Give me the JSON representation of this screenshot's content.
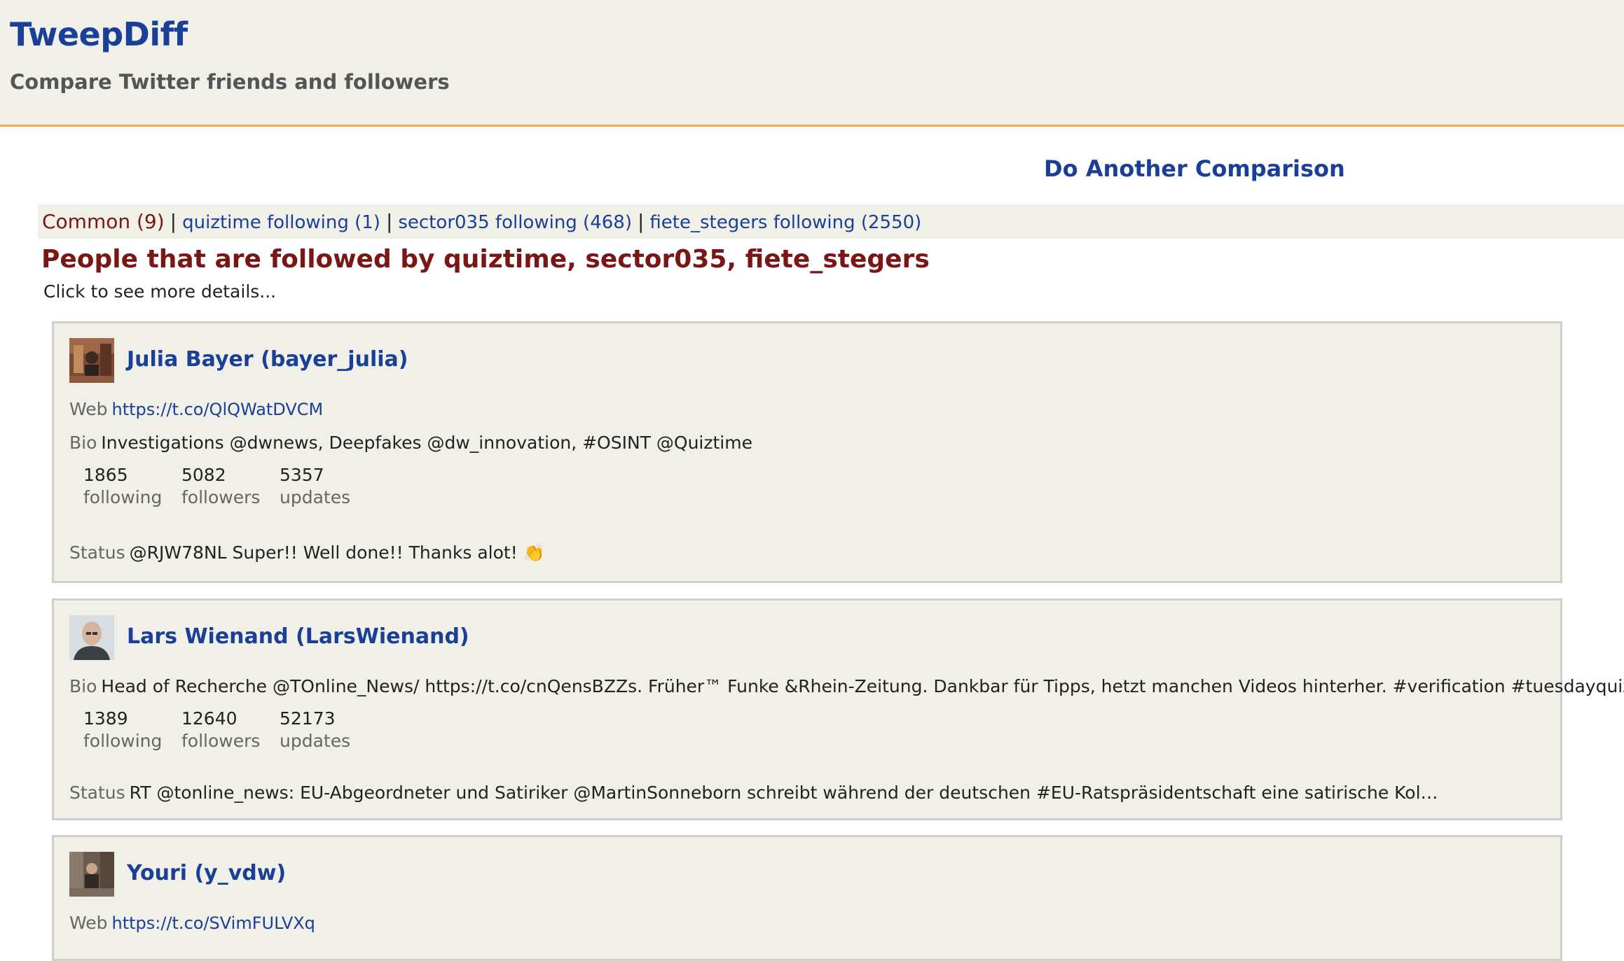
{
  "site": {
    "title": "TweepDiff",
    "tagline": "Compare Twitter friends and followers"
  },
  "actions": {
    "another_comparison": "Do Another Comparison"
  },
  "tabs": {
    "current": "Common (9)",
    "links": [
      "quiztime following (1)",
      "sector035 following (468)",
      "fiete_stegers following (2550)"
    ],
    "separator": "|"
  },
  "section": {
    "title": "People that are followed by quiztime, sector035, fiete_stegers",
    "hint": "Click to see more details..."
  },
  "labels": {
    "web": "Web",
    "bio": "Bio",
    "status": "Status",
    "following": "following",
    "followers": "followers",
    "updates": "updates"
  },
  "people": [
    {
      "name": "Julia Bayer (bayer_julia)",
      "web": "https://t.co/QlQWatDVCM",
      "bio": "Investigations @dwnews, Deepfakes @dw_innovation, #OSINT @Quiztime",
      "following": "1865",
      "followers": "5082",
      "updates": "5357",
      "status": "@RJW78NL Super!! Well done!! Thanks alot! 👏"
    },
    {
      "name": "Lars Wienand (LarsWienand)",
      "web": "",
      "bio": "Head of Recherche @TOnline_News/ https://t.co/cnQensBZZs. Früher™ Funke &Rhein-Zeitung. Dankbar für Tipps, hetzt manchen Videos hinterher. #verification #tuesdayquiz",
      "following": "1389",
      "followers": "12640",
      "updates": "52173",
      "status": "RT @tonline_news: EU-Abgeordneter und Satiriker @MartinSonneborn schreibt während der deutschen #EU-Ratspräsidentschaft eine satirische Kol…"
    },
    {
      "name": "Youri (y_vdw)",
      "web": "https://t.co/SVimFULVXq"
    }
  ],
  "colors": {
    "header_bg": "#f0f0e9",
    "header_border": "#e9b04f",
    "link": "#1a3f96",
    "heading": "#7a1616"
  }
}
